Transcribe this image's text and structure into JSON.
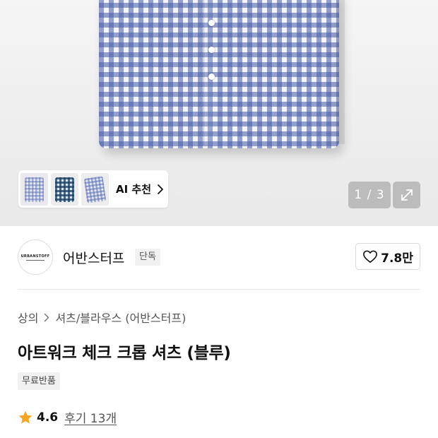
{
  "gallery": {
    "page_indicator": "1 / 3",
    "ai_recommend_label": "AI 추천",
    "thumbnails": [
      "thumb-shirt-checked-light",
      "thumb-shirt-checked-dark",
      "thumb-shirt-checked-folded"
    ]
  },
  "brand": {
    "logo_text": "URBANSTOFF",
    "name": "어반스터프",
    "badge": "단독",
    "like_count": "7.8만"
  },
  "product": {
    "breadcrumb": [
      "상의",
      "셔츠/블라우스 (어반스터프)"
    ],
    "title": "아트워크 체크 크롭 셔츠 (블루)",
    "free_return_badge": "무료반품",
    "rating": "4.6",
    "reviews_label": "후기 13개"
  },
  "colors": {
    "star": "#f5a623",
    "check_pattern": "#4a5aa5"
  }
}
